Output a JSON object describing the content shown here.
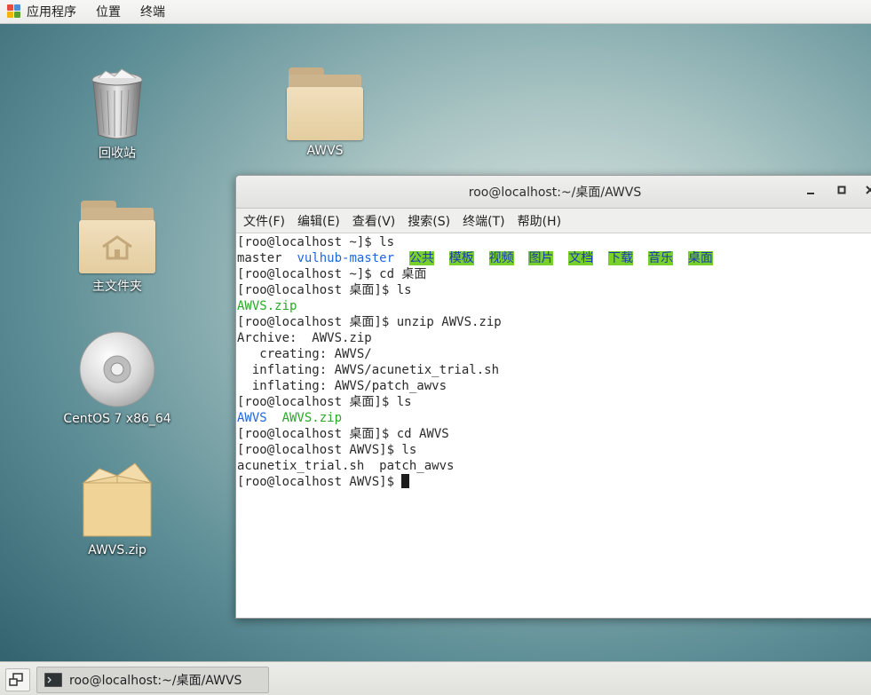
{
  "top_bar": {
    "applications": "应用程序",
    "places": "位置",
    "terminal": "终端"
  },
  "desktop": {
    "icons": [
      {
        "label": "回收站",
        "icon": "trash-icon"
      },
      {
        "label": "AWVS",
        "icon": "folder-icon"
      },
      {
        "label": "主文件夹",
        "icon": "home-folder-icon"
      },
      {
        "label": "CentOS 7 x86_64",
        "icon": "disc-icon"
      },
      {
        "label": "AWVS.zip",
        "icon": "package-icon"
      }
    ]
  },
  "terminal": {
    "title": "roo@localhost:~/桌面/AWVS",
    "menu": [
      "文件(F)",
      "编辑(E)",
      "查看(V)",
      "搜索(S)",
      "终端(T)",
      "帮助(H)"
    ],
    "lines": {
      "l1": "[roo@localhost ~]$ ls",
      "l2_master": "master",
      "l2_vulhub": "vulhub-master",
      "l2_dirs": [
        "公共",
        "模板",
        "视频",
        "图片",
        "文档",
        "下载",
        "音乐",
        "桌面"
      ],
      "l3": "[roo@localhost ~]$ cd 桌面",
      "l4": "[roo@localhost 桌面]$ ls",
      "l5": "AWVS.zip",
      "l6": "[roo@localhost 桌面]$ unzip AWVS.zip",
      "l7": "Archive:  AWVS.zip",
      "l8": "   creating: AWVS/",
      "l9": "  inflating: AWVS/acunetix_trial.sh",
      "l10": "  inflating: AWVS/patch_awvs",
      "l11": "[roo@localhost 桌面]$ ls",
      "l12_dir": "AWVS",
      "l12_zip": "AWVS.zip",
      "l13": "[roo@localhost 桌面]$ cd AWVS",
      "l14": "[roo@localhost AWVS]$ ls",
      "l15": "acunetix_trial.sh  patch_awvs",
      "l16": "[roo@localhost AWVS]$ "
    }
  },
  "taskbar": {
    "window_label": "roo@localhost:~/桌面/AWVS"
  },
  "colors": {
    "ls_dir_highlight": "#7ad02a",
    "ls_dir_text": "#1a3cb0",
    "archive_green": "#2aa82a",
    "dir_blue": "#2266dd"
  }
}
